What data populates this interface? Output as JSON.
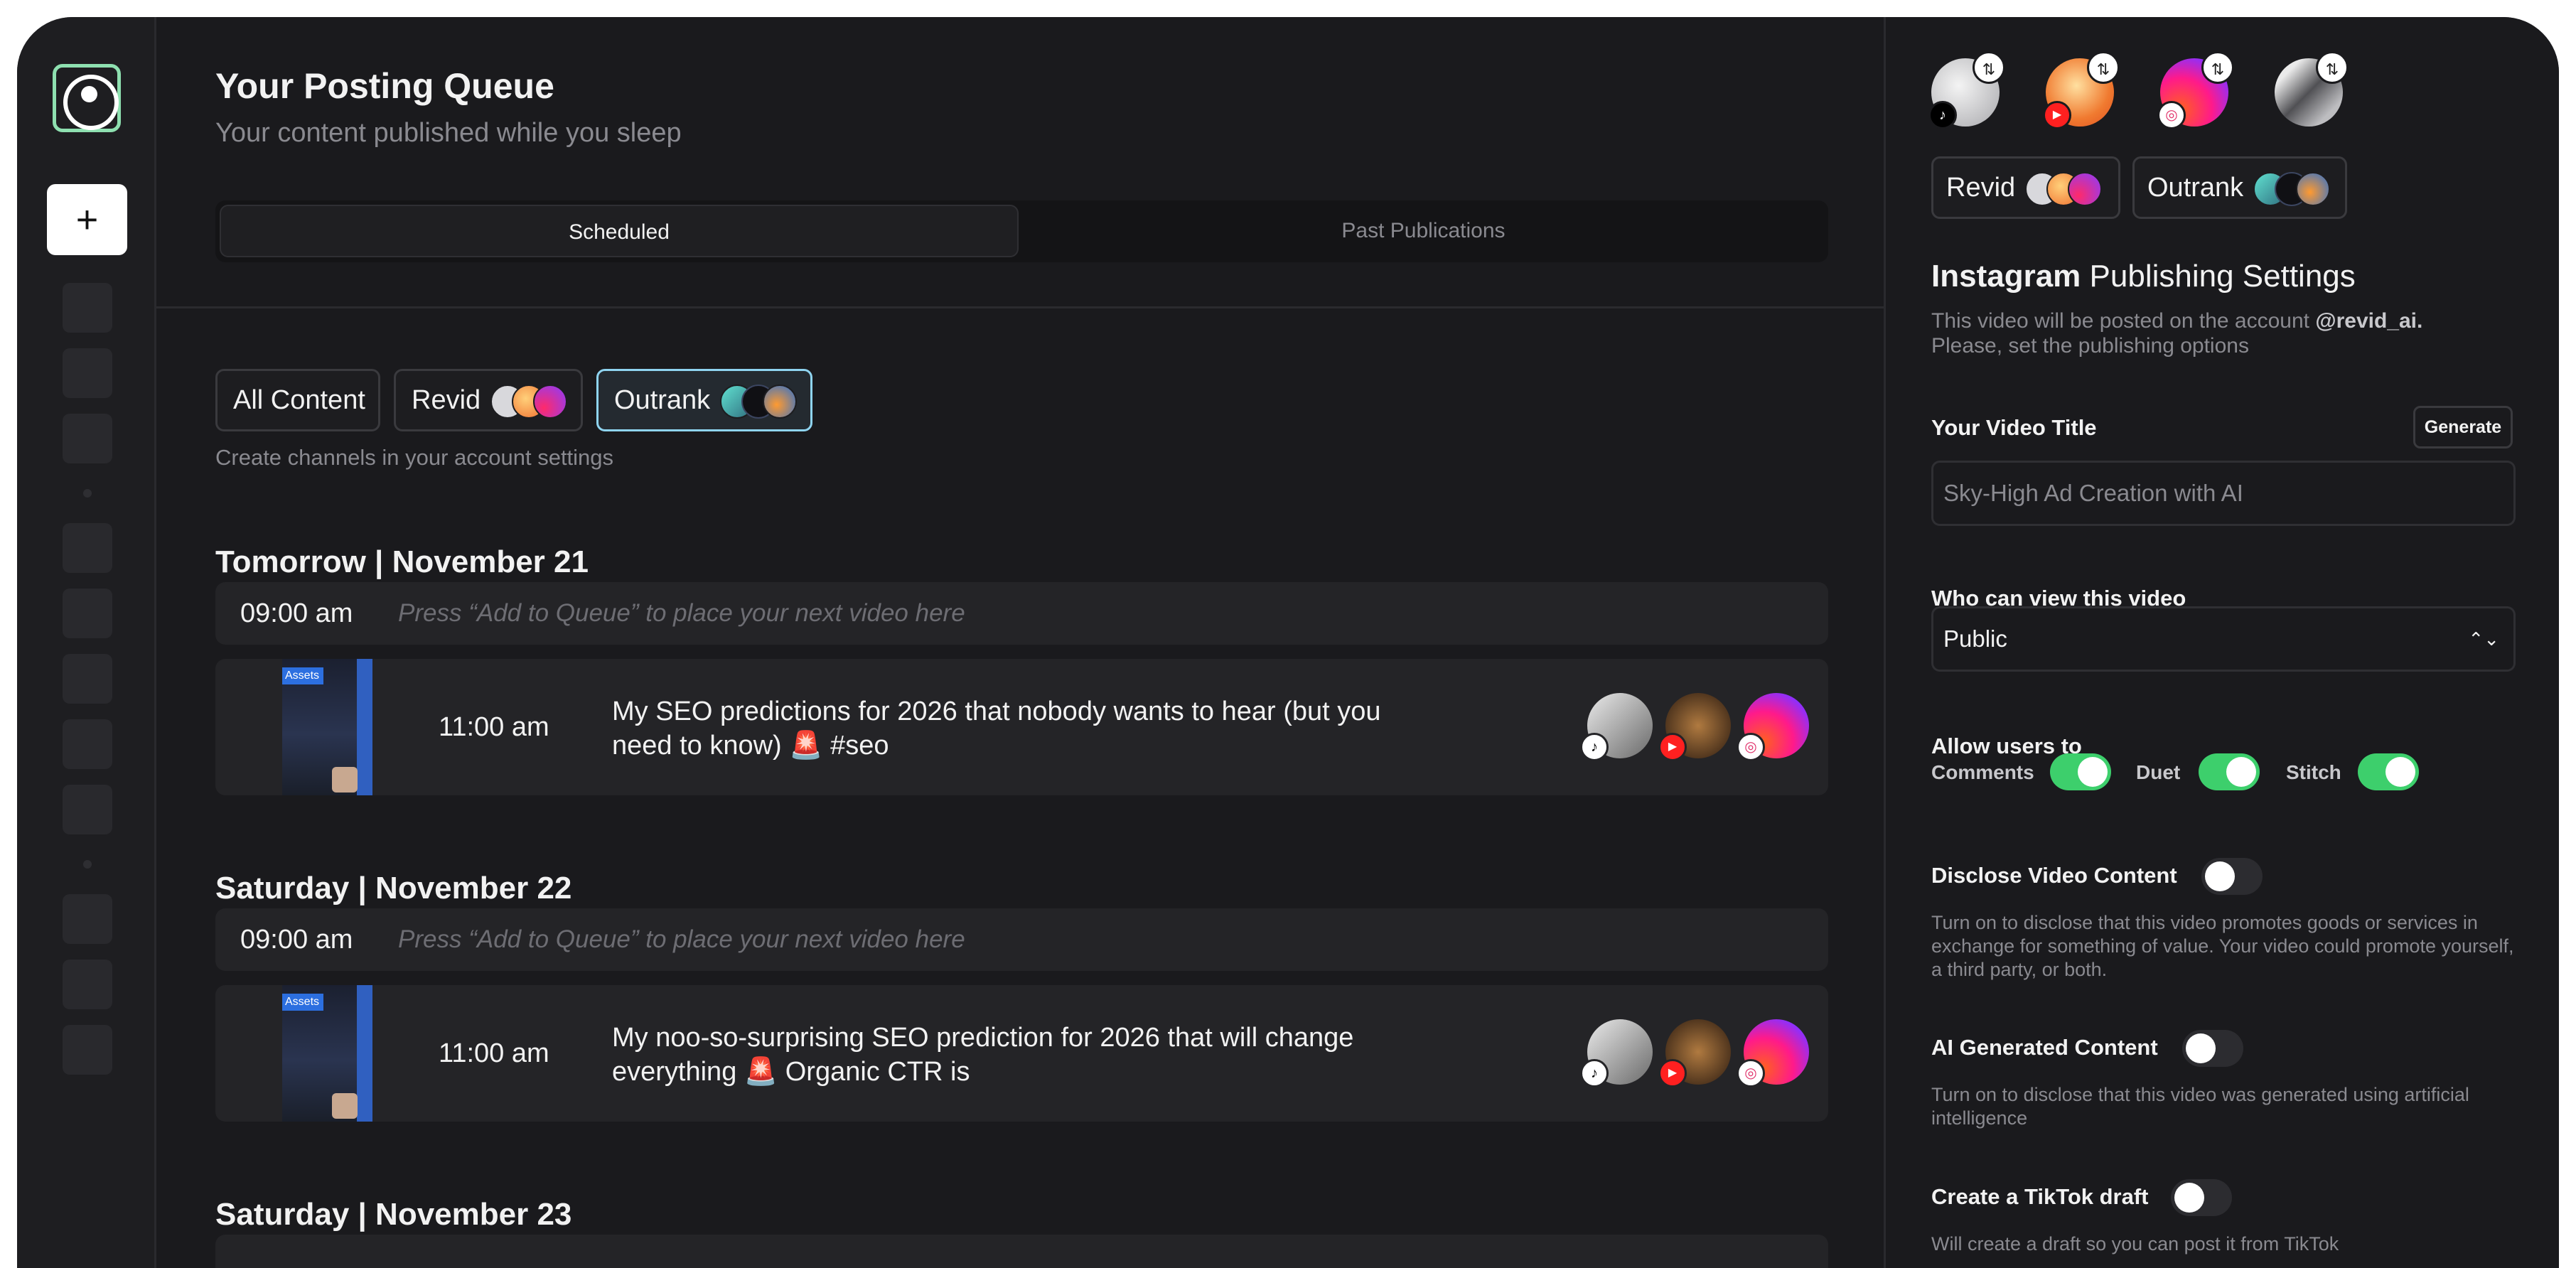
{
  "sidebar": {
    "new_label": "+"
  },
  "header": {
    "title": "Your Posting Queue",
    "subtitle": "Your content published while you sleep"
  },
  "tabs": [
    {
      "label": "Scheduled",
      "active": true
    },
    {
      "label": "Past Publications",
      "active": false
    }
  ],
  "filters": {
    "chips": [
      {
        "label": "All Content",
        "selected": false
      },
      {
        "label": "Revid",
        "selected": false
      },
      {
        "label": "Outrank",
        "selected": true
      }
    ],
    "hint": "Create channels in your account settings"
  },
  "queue": [
    {
      "day": "Tomorrow | November 21",
      "slot": {
        "time": "09:00 am",
        "hint": "Press “Add to Queue” to place your next video here"
      },
      "post": {
        "time": "11:00 am",
        "text": "My SEO predictions for 2026 that nobody wants to hear (but you need to know) 🚨 #seo",
        "thumb_tag": "Assets"
      }
    },
    {
      "day": "Saturday | November 22",
      "slot": {
        "time": "09:00 am",
        "hint": "Press “Add to Queue” to place your next video here"
      },
      "post": {
        "time": "11:00 am",
        "text": "My noo-so-surprising SEO prediction for 2026 that will change everything 🚨 Organic CTR is",
        "thumb_tag": "Assets"
      }
    },
    {
      "day": "Saturday | November 23"
    }
  ],
  "channels": {
    "revid": "Revid",
    "outrank": "Outrank"
  },
  "settings": {
    "platform": "Instagram",
    "heading_rest": "Publishing Settings",
    "desc_prefix": "This video will be posted on the account",
    "account": "@revid_ai.",
    "desc_suffix": "Please, set the publishing options",
    "video_title_label": "Your Video Title",
    "generate_label": "Generate",
    "video_title_placeholder": "Sky-High Ad Creation with AI",
    "visibility_label": "Who can view this video",
    "visibility_value": "Public",
    "allow_label": "Allow users to",
    "toggles": [
      {
        "label": "Comments",
        "on": true
      },
      {
        "label": "Duet",
        "on": true
      },
      {
        "label": "Stitch",
        "on": true
      }
    ],
    "disclose_label": "Disclose Video Content",
    "disclose_on": false,
    "disclose_desc": "Turn on to disclose that this video promotes goods or services in exchange for something of value. Your video could promote yourself, a third party, or both.",
    "ai_label": "AI Generated Content",
    "ai_on": false,
    "ai_desc": "Turn on to disclose that this video was generated using artificial intelligence",
    "draft_label": "Create a TikTok draft",
    "draft_on": false,
    "draft_desc": "Will create a draft so you can post it from TikTok"
  },
  "colors": {
    "accent_green": "#3dcf6c",
    "selected_border": "#8fd4f0",
    "logo": "#8ee0b0",
    "background": "#1a1a1d"
  }
}
